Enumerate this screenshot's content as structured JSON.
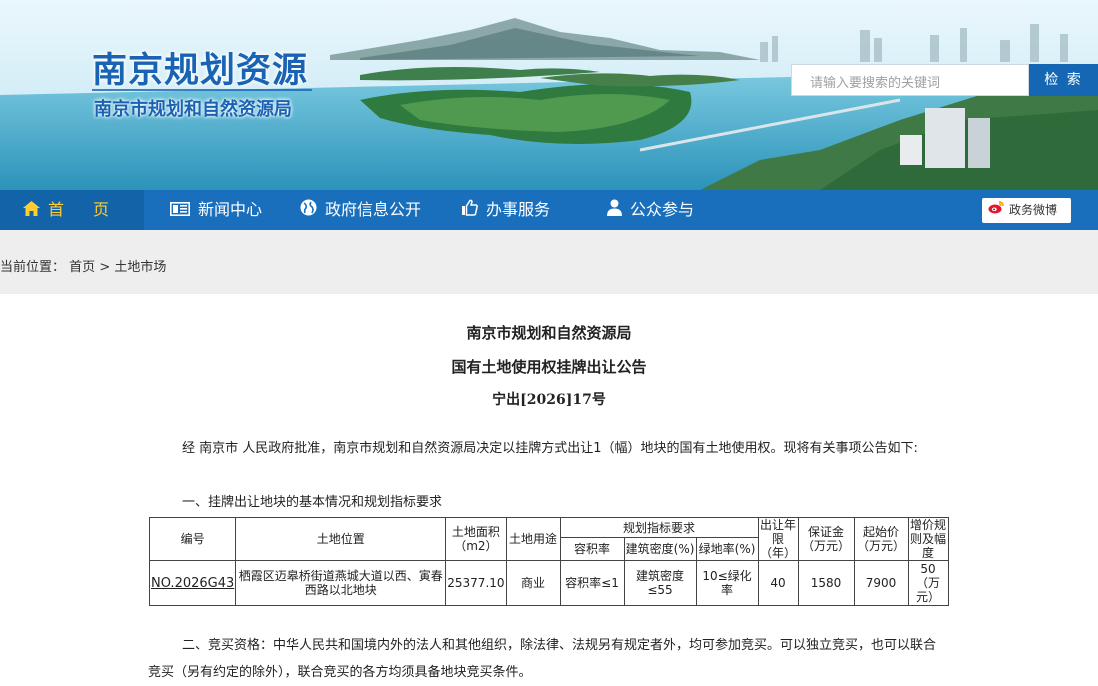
{
  "header": {
    "site_title": "南京规划资源",
    "site_subtitle": "南京市规划和自然资源局",
    "search_placeholder": "请输入要搜索的关键词",
    "search_button": "检 索"
  },
  "nav": {
    "items": [
      {
        "label": "首  页",
        "icon": "home-icon"
      },
      {
        "label": "新闻中心",
        "icon": "news-icon"
      },
      {
        "label": "政府信息公开",
        "icon": "globe-icon"
      },
      {
        "label": "办事服务",
        "icon": "thumbs-up-icon"
      },
      {
        "label": "公众参与",
        "icon": "user-icon"
      }
    ],
    "weibo": "政务微博"
  },
  "breadcrumb": {
    "prefix": "当前位置：",
    "home": "首页",
    "separator": ">",
    "current": "土地市场"
  },
  "article": {
    "org": "南京市规划和自然资源局",
    "title": "国有土地使用权挂牌出让公告",
    "number": "宁出[2026]17号",
    "intro": "经 南京市 人民政府批准，南京市规划和自然资源局决定以挂牌方式出让1（幅）地块的国有土地使用权。现将有关事项公告如下:",
    "section1": "一、挂牌出让地块的基本情况和规划指标要求",
    "section2": "二、竞买资格：中华人民共和国境内外的法人和其他组织，除法律、法规另有规定者外，均可参加竞买。可以独立竞买，也可以联合竞买（另有约定的除外），联合竞买的各方均须具备地块竞买条件。"
  },
  "table": {
    "headers": {
      "code": "编号",
      "location": "土地位置",
      "area": "土地面积（m2）",
      "use": "土地用途",
      "planning": "规划指标要求",
      "far": "容积率",
      "density": "建筑密度(%)",
      "green": "绿地率(%)",
      "term": "出让年限（年）",
      "deposit": "保证金（万元）",
      "start_price": "起始价（万元）",
      "increment": "增价规则及幅度"
    },
    "rows": [
      {
        "code": "NO.2026G43",
        "location": "栖霞区迈皋桥街道燕城大道以西、寅春西路以北地块",
        "area": "25377.10",
        "use": "商业",
        "far": "容积率≤1",
        "density": "建筑密度≤55",
        "green": "10≤绿化率",
        "term": "40",
        "deposit": "1580",
        "start_price": "7900",
        "increment": "50（万元）"
      }
    ]
  },
  "colors": {
    "brand_blue": "#1a6fbd",
    "nav_active": "#1363a8",
    "home_highlight": "#ffcc33",
    "title_blue": "#1a63b4"
  }
}
